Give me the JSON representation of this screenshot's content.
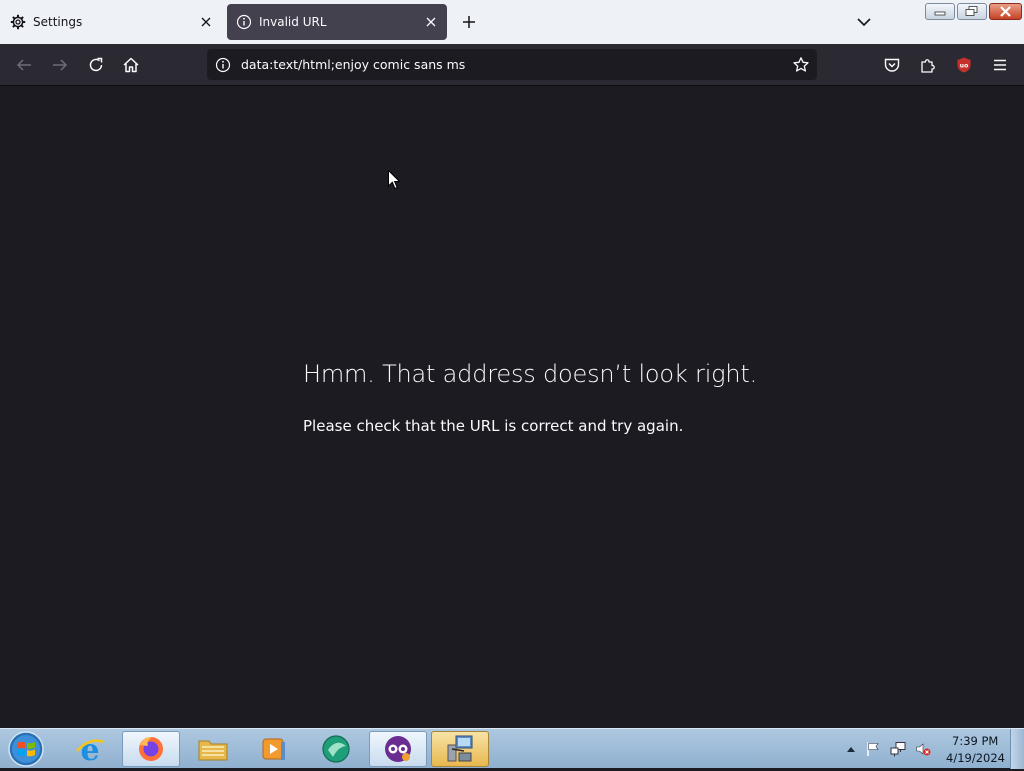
{
  "tabs": [
    {
      "label": "Settings",
      "icon": "gear-icon",
      "active": false
    },
    {
      "label": "Invalid URL",
      "icon": "info-icon",
      "active": true
    }
  ],
  "urlbar": {
    "value": "data:text/html;enjoy comic sans ms"
  },
  "error": {
    "title": "Hmm. That address doesn’t look right.",
    "description": "Please check that the URL is correct and try again."
  },
  "taskbar": {
    "apps": [
      "internet-explorer",
      "firefox",
      "file-explorer",
      "media-player",
      "remote-app",
      "fanciful-app",
      "network-setup"
    ],
    "clock_time": "7:39 PM",
    "clock_date": "4/19/2024"
  },
  "colors": {
    "content_bg": "#1c1b22",
    "toolbar_bg": "#2b2a33",
    "active_tab_bg": "#42414d",
    "accent_red": "#c4302b"
  }
}
